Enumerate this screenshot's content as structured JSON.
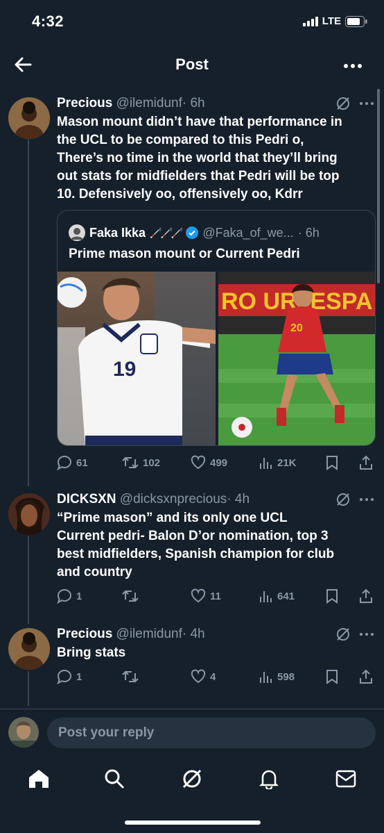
{
  "status": {
    "time": "4:32",
    "network": "LTE"
  },
  "header": {
    "title": "Post"
  },
  "tweets": [
    {
      "name": "Precious",
      "handle": "@ilemidunf",
      "time": "· 6h",
      "text": [
        "Mason mount didn’t have that performance in",
        "the UCL to be compared to this Pedri o,",
        "There’s no time in the world that they’ll bring",
        "out stats for midfielders that Pedri will be top",
        "10. Defensively oo, offensively oo, Kdrr"
      ],
      "quote": {
        "name": "Faka Ikka",
        "emoji": "🦯🦯🦯",
        "handle": "@Faka_of_we...",
        "time": "· 6h",
        "text": "Prime mason mount or Current Pedri",
        "shirt_left": "19",
        "shirt_right": "20",
        "banner_text": "RO  URI  ESPA"
      },
      "actions": {
        "replies": "61",
        "retweets": "102",
        "likes": "499",
        "views": "21K"
      }
    },
    {
      "name": "DICKSXN",
      "handle": "@dicksxnprecious",
      "time": "· 4h",
      "text": [
        "“Prime mason” and its only one UCL",
        "Current pedri- Balon D’or nomination, top 3",
        "best midfielders, Spanish champion for club",
        "and country"
      ],
      "actions": {
        "replies": "1",
        "retweets": "",
        "likes": "11",
        "views": "641"
      }
    },
    {
      "name": "Precious",
      "handle": "@ilemidunf",
      "time": "· 4h",
      "text": [
        "Bring stats"
      ],
      "actions": {
        "replies": "1",
        "retweets": "",
        "likes": "4",
        "views": "598"
      }
    }
  ],
  "reply": {
    "placeholder": "Post your reply"
  },
  "nav": [
    "home-icon",
    "search-icon",
    "grok-icon",
    "notifications-icon",
    "messages-icon"
  ],
  "colors": {
    "background": "#15202b",
    "muted": "#8b98a5",
    "border": "#38444d",
    "verified": "#1d9bf0"
  }
}
